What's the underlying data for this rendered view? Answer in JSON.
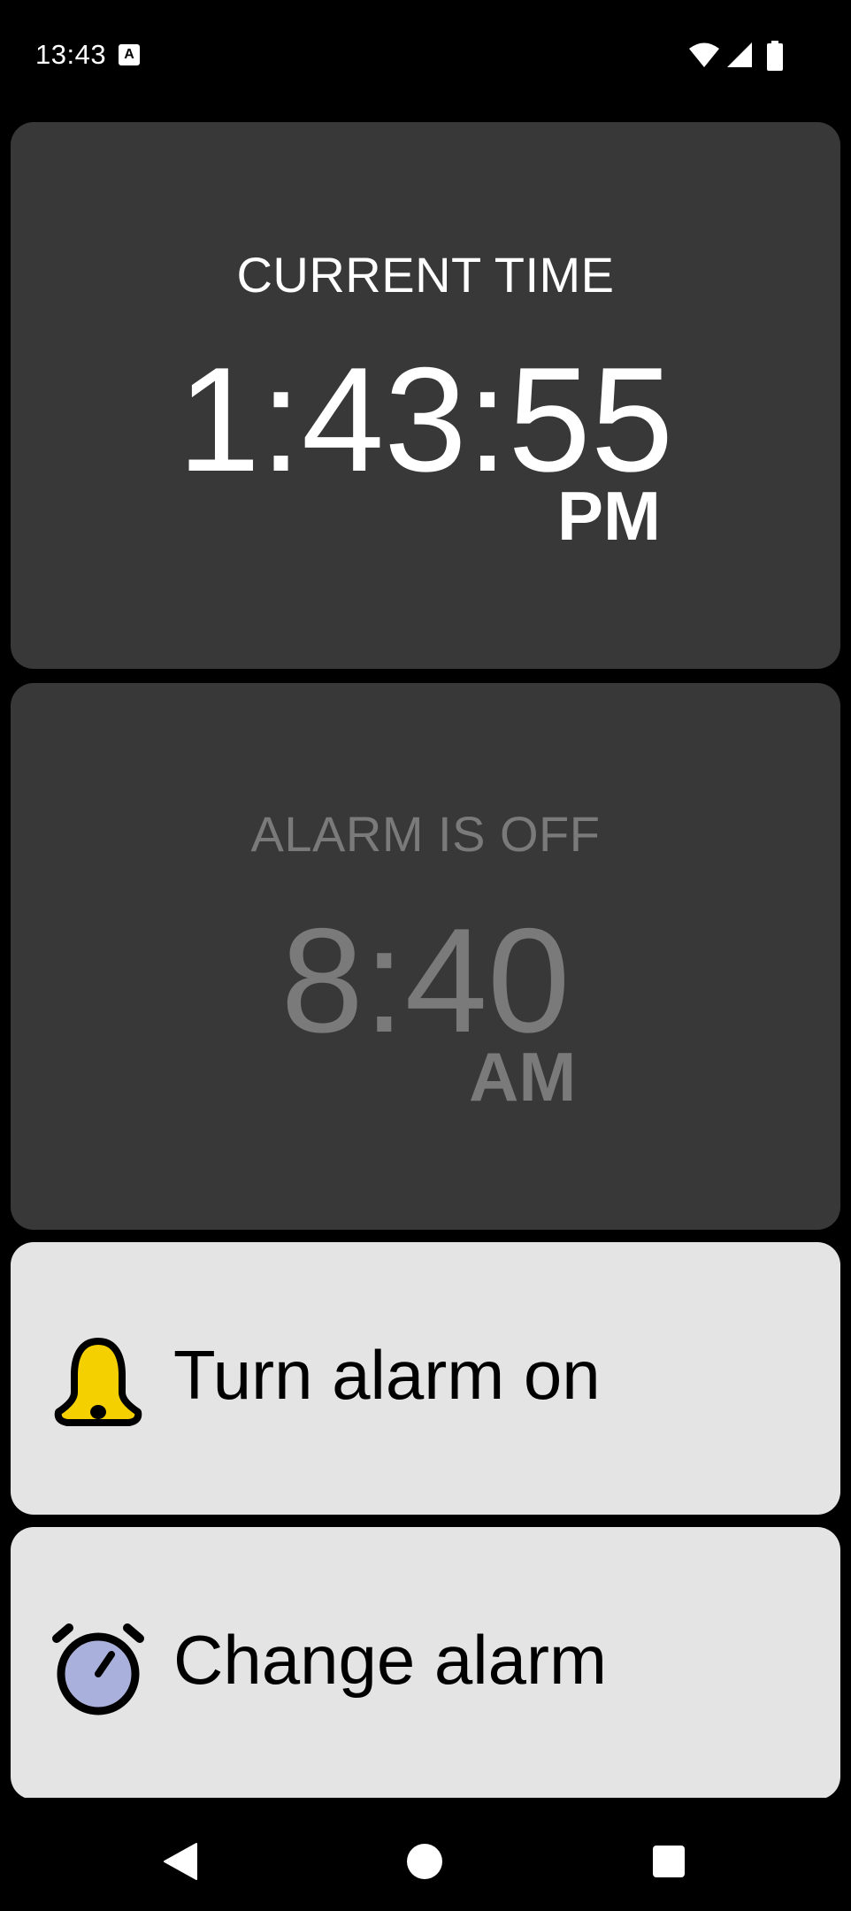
{
  "status_bar": {
    "time": "13:43",
    "indicator_letter": "A",
    "icons": [
      "wifi-icon",
      "signal-icon",
      "battery-icon"
    ]
  },
  "current_time": {
    "heading": "CURRENT TIME",
    "time": "1:43:55",
    "period": "PM"
  },
  "alarm": {
    "heading": "ALARM IS OFF",
    "time": "8:40",
    "period": "AM"
  },
  "actions": {
    "turn_on_label": "Turn alarm on",
    "turn_on_icon": "bell-icon",
    "change_label": "Change alarm",
    "change_icon": "alarm-clock-icon"
  },
  "colors": {
    "card_dark": "#383838",
    "card_light": "#e4e4e4",
    "inactive_text": "#7a7a7a",
    "bell_yellow": "#f5d000",
    "clock_face": "#aab0dc"
  },
  "navigation": [
    "back-button",
    "home-button",
    "recents-button"
  ]
}
